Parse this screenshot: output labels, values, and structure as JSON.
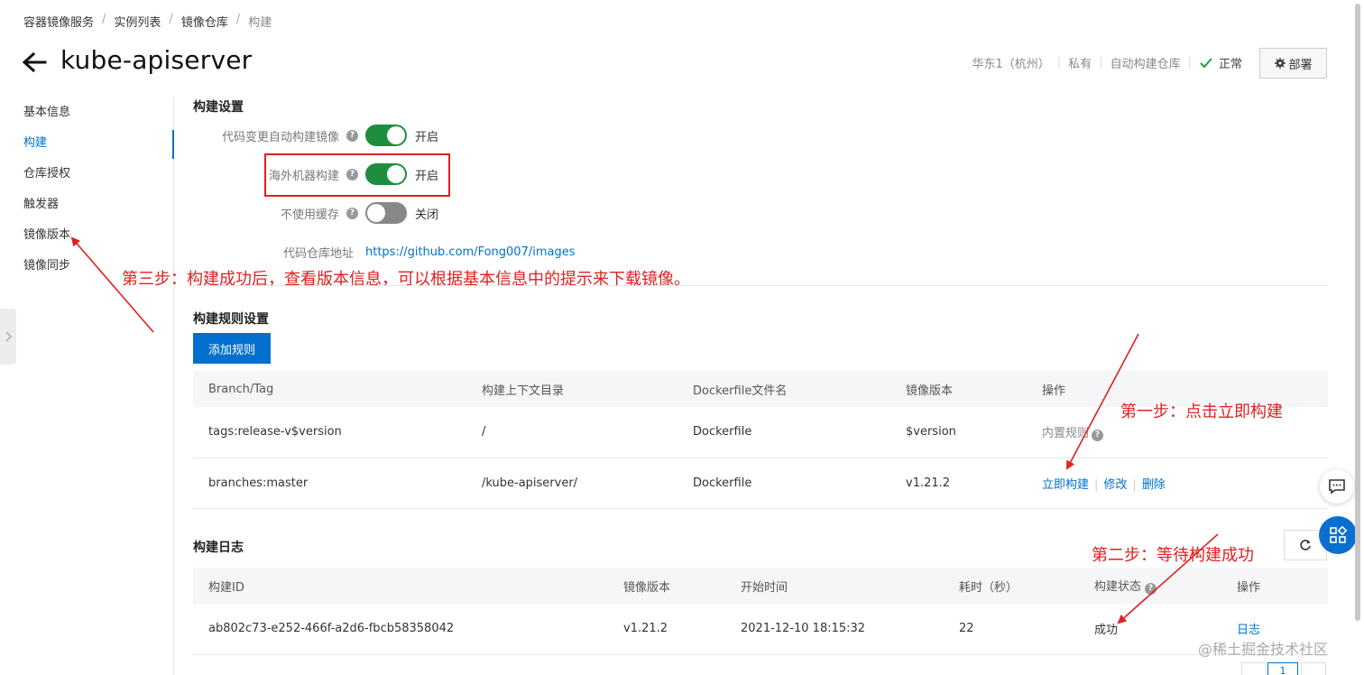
{
  "breadcrumb": [
    "容器镜像服务",
    "实例列表",
    "镜像仓库",
    "构建"
  ],
  "page_title": "kube-apiserver",
  "meta": {
    "region": "华东1（杭州）",
    "visibility": "私有",
    "repo_type": "自动构建仓库",
    "status": "正常"
  },
  "deploy_label": "部署",
  "sidebar": {
    "items": [
      {
        "label": "基本信息"
      },
      {
        "label": "构建"
      },
      {
        "label": "仓库授权"
      },
      {
        "label": "触发器"
      },
      {
        "label": "镜像版本"
      },
      {
        "label": "镜像同步"
      }
    ]
  },
  "build_settings": {
    "title": "构建设置",
    "rows": [
      {
        "label": "代码变更自动构建镜像",
        "state": "开启"
      },
      {
        "label": "海外机器构建",
        "state": "开启"
      },
      {
        "label": "不使用缓存",
        "state": "关闭"
      }
    ],
    "repo_label": "代码仓库地址",
    "repo_url": "https://github.com/Fong007/images"
  },
  "build_rules": {
    "title": "构建规则设置",
    "add_label": "添加规则",
    "columns": [
      "Branch/Tag",
      "构建上下文目录",
      "Dockerfile文件名",
      "镜像版本",
      "操作"
    ],
    "rows": [
      {
        "branch": "tags:release-v$version",
        "context": "/",
        "dockerfile": "Dockerfile",
        "version": "$version",
        "op": "内置规则"
      },
      {
        "branch": "branches:master",
        "context": "/kube-apiserver/",
        "dockerfile": "Dockerfile",
        "version": "v1.21.2",
        "op_build": "立即构建",
        "op_edit": "修改",
        "op_delete": "删除"
      }
    ]
  },
  "build_log": {
    "title": "构建日志",
    "columns": [
      "构建ID",
      "镜像版本",
      "开始时间",
      "耗时（秒）",
      "构建状态",
      "操作"
    ],
    "rows": [
      {
        "id": "ab802c73-e252-466f-a2d6-fbcb58358042",
        "version": "v1.21.2",
        "start": "2021-12-10 18:15:32",
        "duration": "22",
        "status": "成功",
        "op": "日志"
      }
    ]
  },
  "annotations": {
    "step1": "第一步：点击立即构建",
    "step2": "第二步：等待构建成功",
    "step3": "第三步：构建成功后，查看版本信息，可以根据基本信息中的提示来下载镜像。"
  },
  "pagination": {
    "current": "1"
  },
  "watermark": "@稀土掘金技术社区",
  "colors": {
    "accent": "#0070cc",
    "success": "#1e8e3e",
    "annotation": "#e02020"
  }
}
